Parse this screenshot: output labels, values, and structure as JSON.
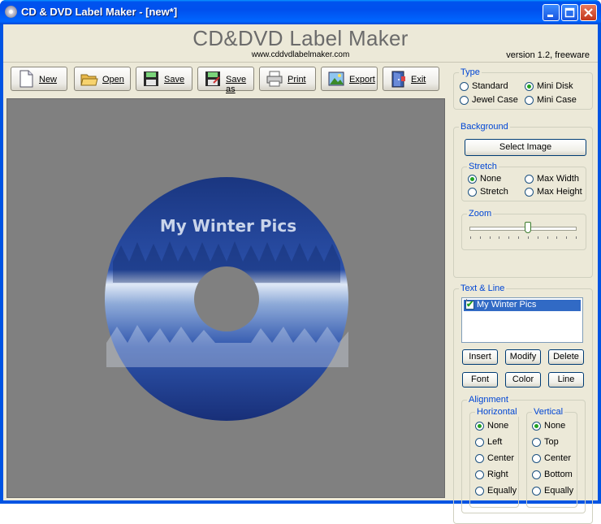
{
  "window": {
    "title": "CD & DVD Label Maker - [new*]",
    "icon": "cd-icon",
    "controls": [
      "minimize-icon",
      "maximize-icon",
      "close-icon"
    ]
  },
  "header": {
    "app_title": "CD&DVD Label Maker",
    "url": "www.cddvdlabelmaker.com",
    "version": "version 1.2, freeware"
  },
  "toolbar": {
    "buttons": [
      {
        "label": "New",
        "icon": "new-document-icon"
      },
      {
        "label": "Open",
        "icon": "open-folder-icon"
      },
      {
        "label": "Save",
        "icon": "floppy-disk-icon"
      },
      {
        "label": "Save as",
        "icon": "save-as-icon"
      },
      {
        "label": "Print",
        "icon": "printer-icon"
      },
      {
        "label": "Export",
        "icon": "export-image-icon"
      },
      {
        "label": "Exit",
        "icon": "exit-door-icon"
      }
    ]
  },
  "canvas": {
    "label_text": "My Winter Pics",
    "background": "#808080",
    "disc_colors": {
      "dark": "#1b3a8a",
      "mid": "#2f56b0",
      "light": "#b8cbe8"
    }
  },
  "type_group": {
    "legend": "Type",
    "options": [
      "Standard",
      "Mini Disk",
      "Jewel Case",
      "Mini Case"
    ],
    "selected": "Mini Disk"
  },
  "background_group": {
    "legend": "Background",
    "select_image": "Select Image",
    "stretch": {
      "legend": "Stretch",
      "options": [
        "None",
        "Max Width",
        "Stretch",
        "Max Height"
      ],
      "selected": "None"
    },
    "zoom": {
      "legend": "Zoom",
      "level": 0.55
    }
  },
  "text_line_group": {
    "legend": "Text & Line",
    "items": [
      {
        "text": "My Winter Pics",
        "checked": true
      }
    ],
    "buttons": [
      "Insert",
      "Modify",
      "Delete",
      "Font",
      "Color",
      "Line"
    ],
    "alignment": {
      "legend": "Alignment",
      "horizontal": {
        "legend": "Horizontal",
        "options": [
          "None",
          "Left",
          "Center",
          "Right",
          "Equally"
        ],
        "selected": "None"
      },
      "vertical": {
        "legend": "Vertical",
        "options": [
          "None",
          "Top",
          "Center",
          "Bottom",
          "Equally"
        ],
        "selected": "None"
      }
    }
  }
}
